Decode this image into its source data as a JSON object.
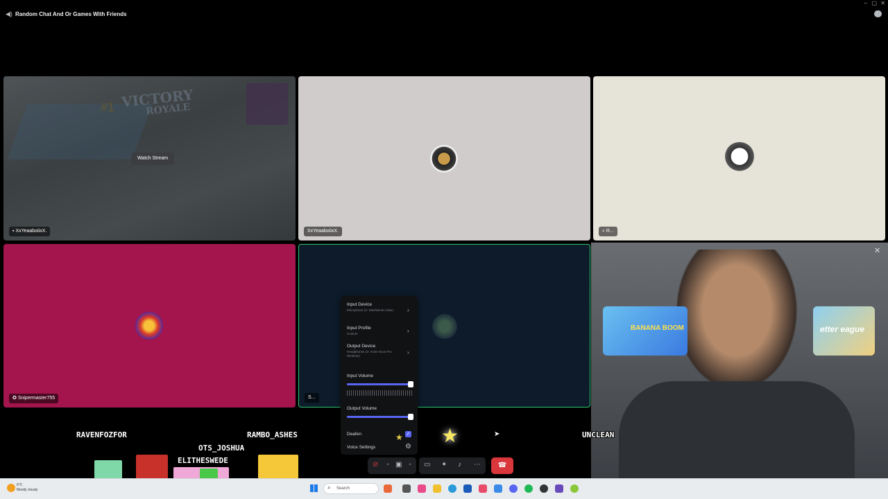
{
  "window": {
    "title": "Random Chat And Or Games With Friends",
    "minimize": "–",
    "maximize": "▢",
    "close": "✕"
  },
  "tiles": [
    {
      "name": "XxYeaaboiixX.",
      "overlay": "Watch Stream",
      "bg": "#5b6062",
      "stream_text_1": "VICTORY",
      "stream_text_2": "ROYALE",
      "stream_rank": "#1"
    },
    {
      "name": "XxYeaaboiixX.",
      "bg": "#cfcccb"
    },
    {
      "name": "R...",
      "bg": "#e6e3d9"
    },
    {
      "name": "Snipermaster755",
      "bg": "#a3154c"
    },
    {
      "name": "S...",
      "bg": "#0d1b2a",
      "speaking_border": "#2dc770"
    }
  ],
  "voice_menu": {
    "input_device": {
      "label": "Input Device",
      "value": "Microphone (3- SteelSeries Alias)"
    },
    "input_profile": {
      "label": "Input Profile",
      "value": "Custom"
    },
    "output_device": {
      "label": "Output Device",
      "value": "Headphones (3- Arctis Nova Pro Wireless)"
    },
    "input_volume": {
      "label": "Input Volume",
      "level": 1.0
    },
    "output_volume": {
      "label": "Output Volume",
      "level": 1.0
    },
    "deafen": {
      "label": "Deafen",
      "checked": true
    },
    "voice_settings": {
      "label": "Voice Settings"
    }
  },
  "overlay_names": [
    "RAVENFOZFOR",
    "RAMBO_ASHES",
    "OTS_JOSHUA",
    "ELITHESWEDE",
    "UNCLEAN"
  ],
  "banners": [
    "BANANA BOOM",
    "etter eague"
  ],
  "taskbar": {
    "weather_temp": "6°C",
    "weather_desc": "Mostly cloudy",
    "search_placeholder": "Search"
  },
  "colors": {
    "accent": "#5865f2",
    "leave": "#da373c",
    "speaking": "#2dc770"
  }
}
